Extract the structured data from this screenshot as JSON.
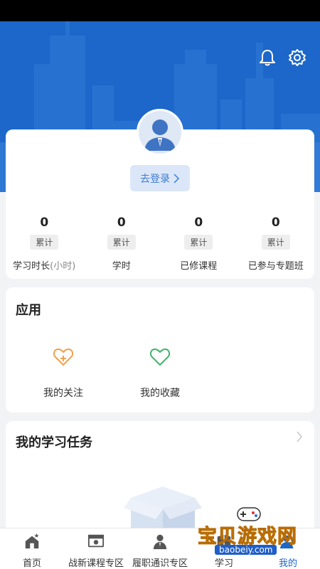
{
  "header": {
    "bell_icon": "bell-icon",
    "settings_icon": "gear-icon"
  },
  "profile": {
    "avatar_icon": "user-avatar-icon",
    "login_label": "去登录"
  },
  "stats": [
    {
      "value": "0",
      "badge": "累计",
      "label": "学习时长",
      "unit": "(小时)"
    },
    {
      "value": "0",
      "badge": "累计",
      "label": "学时",
      "unit": ""
    },
    {
      "value": "0",
      "badge": "累计",
      "label": "已修课程",
      "unit": ""
    },
    {
      "value": "0",
      "badge": "累计",
      "label": "已参与专题班",
      "unit": ""
    }
  ],
  "apps": {
    "title": "应用",
    "items": [
      {
        "label": "我的关注",
        "icon": "heart-plus-icon",
        "color": "#f0a04b"
      },
      {
        "label": "我的收藏",
        "icon": "heart-icon",
        "color": "#3fb36a"
      }
    ]
  },
  "tasks": {
    "title": "我的学习任务"
  },
  "tabbar": {
    "tabs": [
      {
        "label": "首页",
        "icon": "home-icon"
      },
      {
        "label": "战新课程专区",
        "icon": "video-course-icon"
      },
      {
        "label": "履职通识专区",
        "icon": "person-icon"
      },
      {
        "label": "学习",
        "icon": "study-icon"
      },
      {
        "label": "我的",
        "icon": "profile-icon"
      }
    ],
    "active_index": 4
  },
  "watermark": {
    "text": "宝贝游戏网",
    "url": "baobeiy.com"
  },
  "colors": {
    "brand": "#1c67c9",
    "accent_light": "#dbe7f8"
  }
}
